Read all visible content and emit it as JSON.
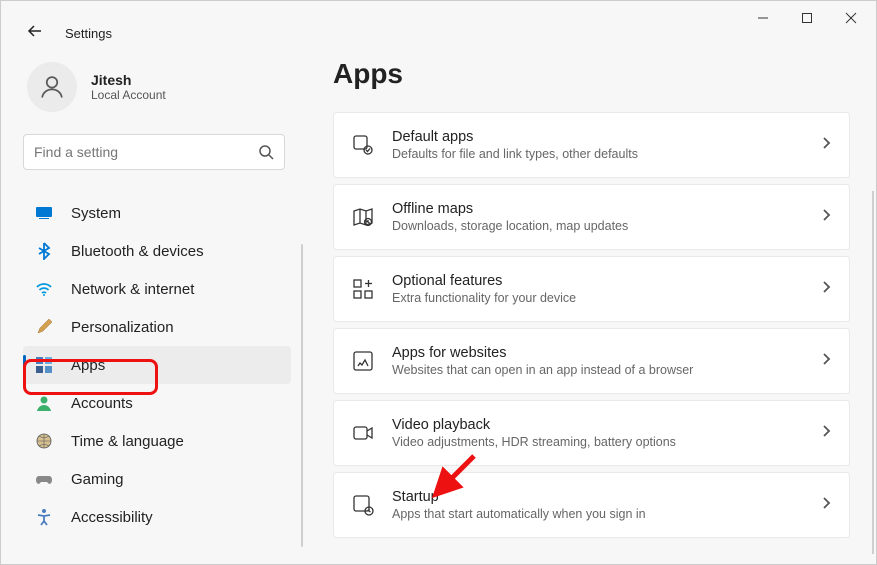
{
  "window": {
    "title": "Settings"
  },
  "user": {
    "name": "Jitesh",
    "subtitle": "Local Account"
  },
  "search": {
    "placeholder": "Find a setting"
  },
  "nav": {
    "items": [
      {
        "label": "System"
      },
      {
        "label": "Bluetooth & devices"
      },
      {
        "label": "Network & internet"
      },
      {
        "label": "Personalization"
      },
      {
        "label": "Apps"
      },
      {
        "label": "Accounts"
      },
      {
        "label": "Time & language"
      },
      {
        "label": "Gaming"
      },
      {
        "label": "Accessibility"
      }
    ]
  },
  "page": {
    "title": "Apps"
  },
  "cards": [
    {
      "title": "Default apps",
      "subtitle": "Defaults for file and link types, other defaults"
    },
    {
      "title": "Offline maps",
      "subtitle": "Downloads, storage location, map updates"
    },
    {
      "title": "Optional features",
      "subtitle": "Extra functionality for your device"
    },
    {
      "title": "Apps for websites",
      "subtitle": "Websites that can open in an app instead of a browser"
    },
    {
      "title": "Video playback",
      "subtitle": "Video adjustments, HDR streaming, battery options"
    },
    {
      "title": "Startup",
      "subtitle": "Apps that start automatically when you sign in"
    }
  ]
}
